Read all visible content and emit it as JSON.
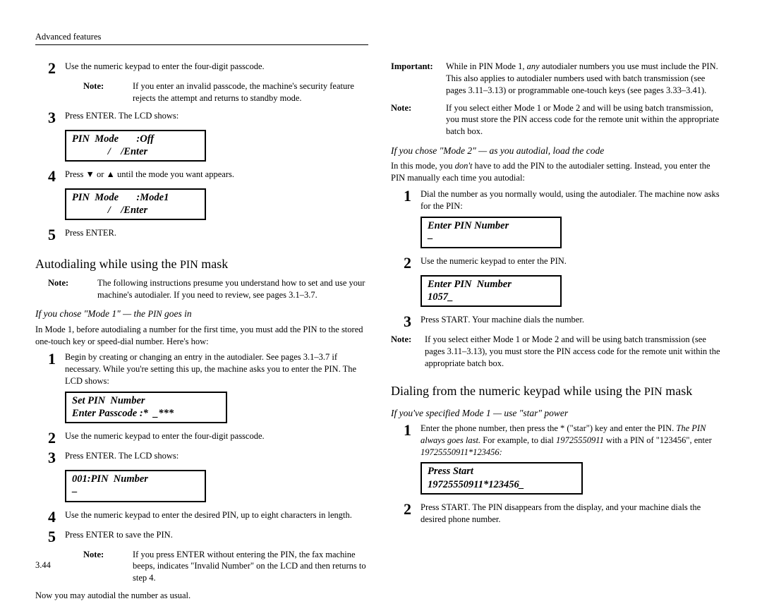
{
  "header": "Advanced features",
  "pageNumber": "3.44",
  "left": {
    "s2": "Use the numeric keypad to enter the four-digit passcode.",
    "s2note": "If you enter an invalid passcode, the machine's security feature rejects the attempt and returns to standby mode.",
    "s3": "Press ENTER. The LCD shows:",
    "lcd1": "PIN  Mode       :Off\n              /    /Enter",
    "s4": "Press ▼ or ▲ until the mode you want appears.",
    "lcd2": "PIN  Mode       :Mode1\n              /    /Enter",
    "s5": "Press ENTER.",
    "h_autodial": "Autodialing while using the PIN mask",
    "autodial_note": "The following instructions presume you understand how to set and use your machine's autodialer. If you need to review, see pages 3.1–3.7.",
    "sub_mode1": "If you chose \"Mode 1\" — the PIN goes in",
    "mode1_para": "In Mode 1, before autodialing a number for the first time, you must add the PIN to the stored one-touch key or speed-dial number. Here's how:",
    "m1s1": "Begin by creating or changing an entry in the autodialer. See pages 3.1–3.7 if necessary. While you're setting this up, the machine asks you to enter the PIN. The LCD shows:",
    "lcd3": "Set PIN  Number\nEnter Passcode :*  _***",
    "m1s2": "Use the numeric keypad to enter the four-digit passcode.",
    "m1s3": "Press ENTER. The LCD shows:",
    "lcd4": "001:PIN  Number\n–",
    "m1s4": "Use the numeric keypad to enter the desired PIN, up to eight characters in length.",
    "m1s5": "Press ENTER to save the PIN.",
    "m1s5note": "If you press ENTER without entering the PIN, the fax machine beeps, indicates \"Invalid Number\" on the LCD and then returns to step 4.",
    "m1_close": "Now you may autodial the number as usual."
  },
  "right": {
    "important_a": "While in PIN Mode 1, ",
    "important_b": "any",
    "important_c": " autodialer numbers you use must include the PIN. This also applies to autodialer numbers used with batch transmission (see pages 3.11–3.13) or programmable one-touch keys (see pages 3.33–3.41).",
    "note1": "If you select either Mode 1 or Mode 2 and will be using batch transmission, you must store the PIN access code for the remote unit within the appropriate batch box.",
    "sub_mode2": "If you chose \"Mode 2\" — as you autodial, load the code",
    "mode2_para_a": "In this mode, you ",
    "mode2_para_b": "don't",
    "mode2_para_c": " have to add the PIN to the autodialer setting. Instead, you enter the PIN manually each time you autodial:",
    "m2s1": "Dial the number as you normally would, using the autodialer. The machine now asks for the PIN:",
    "lcd5": "Enter PIN Number\n–",
    "m2s2": "Use the numeric keypad to enter the PIN.",
    "lcd6": "Enter PIN  Number\n1057_",
    "m2s3": "Press START. Your machine dials the number.",
    "note2": "If you select either Mode 1 or Mode 2 and will be using batch transmission (see pages 3.11–3.13), you must store the PIN access code for the remote unit within the appropriate batch box.",
    "h_dialkeypad": "Dialing from the numeric keypad while using the PIN mask",
    "sub_star": "If you've specified Mode 1 — use \"star\" power",
    "ks1_a": "Enter the phone number, then press the * (\"star\") key and enter the PIN. ",
    "ks1_b": "The PIN always goes last.",
    "ks1_c": " For example, to dial ",
    "ks1_d": "19725550911",
    "ks1_e": " with a PIN of \"123456\", enter ",
    "ks1_f": "19725550911*123456:",
    "lcd7": "Press Start\n19725550911*123456_",
    "ks2": "Press START. The PIN disappears from the display, and your machine dials the desired phone number."
  }
}
